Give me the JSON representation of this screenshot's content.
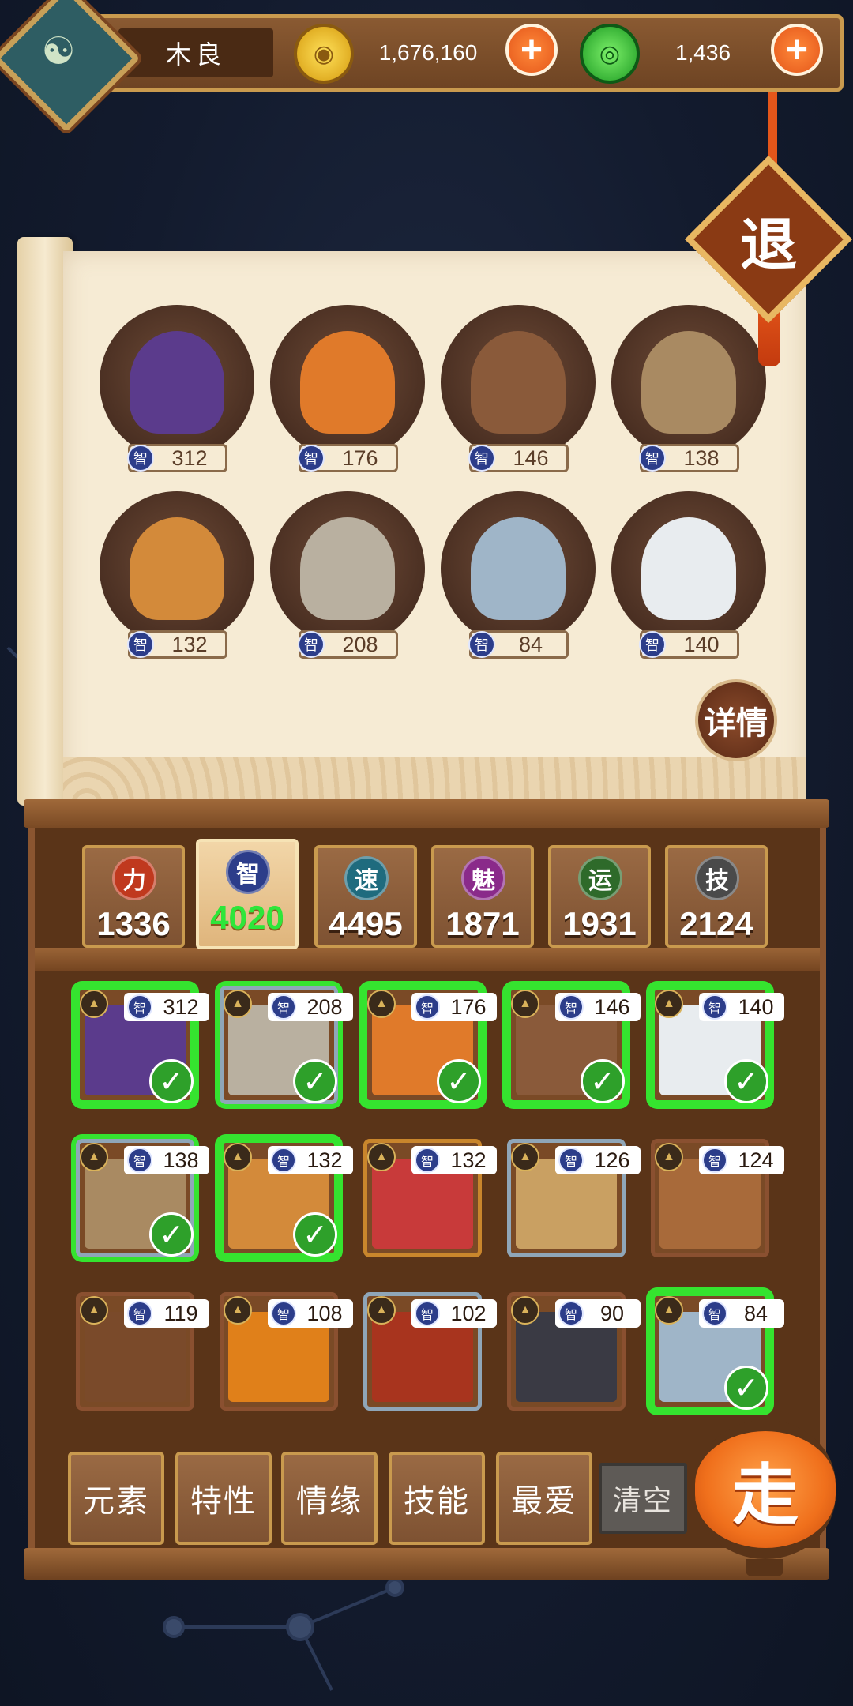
{
  "header": {
    "player_name": "木良",
    "gold_amount": "1,676,160",
    "jade_amount": "1,436",
    "gold_symbol": "◉",
    "jade_symbol": "◎",
    "plus_symbol": "+"
  },
  "exit_button": {
    "label": "退"
  },
  "team": {
    "stat_badge": "智",
    "members": [
      {
        "name": "dj-duo",
        "value": "312",
        "color": "#5b3b8c"
      },
      {
        "name": "monkey-king",
        "value": "176",
        "color": "#e07a2a"
      },
      {
        "name": "monkey-robe",
        "value": "146",
        "color": "#8a5a3a"
      },
      {
        "name": "scholar",
        "value": "138",
        "color": "#a98a62"
      },
      {
        "name": "flower-girl",
        "value": "132",
        "color": "#d38a3a"
      },
      {
        "name": "old-sage",
        "value": "208",
        "color": "#b9b0a0"
      },
      {
        "name": "whale-crew",
        "value": "84",
        "color": "#9fb5c8"
      },
      {
        "name": "mahjong-tile",
        "value": "140",
        "color": "#e8ecef"
      }
    ],
    "detail_label": "详情"
  },
  "attributes": [
    {
      "key": "力",
      "value": "1336",
      "color": "#c0391e",
      "active": false
    },
    {
      "key": "智",
      "value": "4020",
      "color": "#2c3d8a",
      "active": true
    },
    {
      "key": "速",
      "value": "4495",
      "color": "#1f6b7e",
      "active": false
    },
    {
      "key": "魅",
      "value": "1871",
      "color": "#8a2a8a",
      "active": false
    },
    {
      "key": "运",
      "value": "1931",
      "color": "#2e6a2a",
      "active": false
    },
    {
      "key": "技",
      "value": "2124",
      "color": "#4a4a4a",
      "active": false
    }
  ],
  "heroes": {
    "stat_badge": "智",
    "rank_symbol": "▲",
    "check_symbol": "✓",
    "items": [
      {
        "value": "312",
        "selected": true,
        "frame": "gold",
        "color": "#5b3b8c"
      },
      {
        "value": "208",
        "selected": true,
        "frame": "blue",
        "color": "#b9b0a0"
      },
      {
        "value": "176",
        "selected": true,
        "frame": "gold",
        "color": "#e07a2a"
      },
      {
        "value": "146",
        "selected": true,
        "frame": "gold",
        "color": "#8a5a3a"
      },
      {
        "value": "140",
        "selected": true,
        "frame": "gold",
        "color": "#e8ecef"
      },
      {
        "value": "138",
        "selected": true,
        "frame": "blue",
        "color": "#a98a62"
      },
      {
        "value": "132",
        "selected": true,
        "frame": "gold",
        "color": "#d38a3a"
      },
      {
        "value": "132",
        "selected": false,
        "frame": "gold",
        "color": "#c83a3a"
      },
      {
        "value": "126",
        "selected": false,
        "frame": "blue",
        "color": "#c9a062"
      },
      {
        "value": "124",
        "selected": false,
        "frame": "bronze",
        "color": "#a86a3a"
      },
      {
        "value": "119",
        "selected": false,
        "frame": "bronze",
        "color": "#7a4a2a"
      },
      {
        "value": "108",
        "selected": false,
        "frame": "bronze",
        "color": "#e0801a"
      },
      {
        "value": "102",
        "selected": false,
        "frame": "blue",
        "color": "#a8341e"
      },
      {
        "value": "90",
        "selected": false,
        "frame": "bronze",
        "color": "#3a3a44"
      },
      {
        "value": "84",
        "selected": true,
        "frame": "gold",
        "color": "#9fb5c8"
      }
    ]
  },
  "filters": [
    {
      "label": "元素"
    },
    {
      "label": "特性"
    },
    {
      "label": "情缘"
    },
    {
      "label": "技能"
    },
    {
      "label": "最爱"
    }
  ],
  "clear_label": "清空",
  "go_label": "走"
}
